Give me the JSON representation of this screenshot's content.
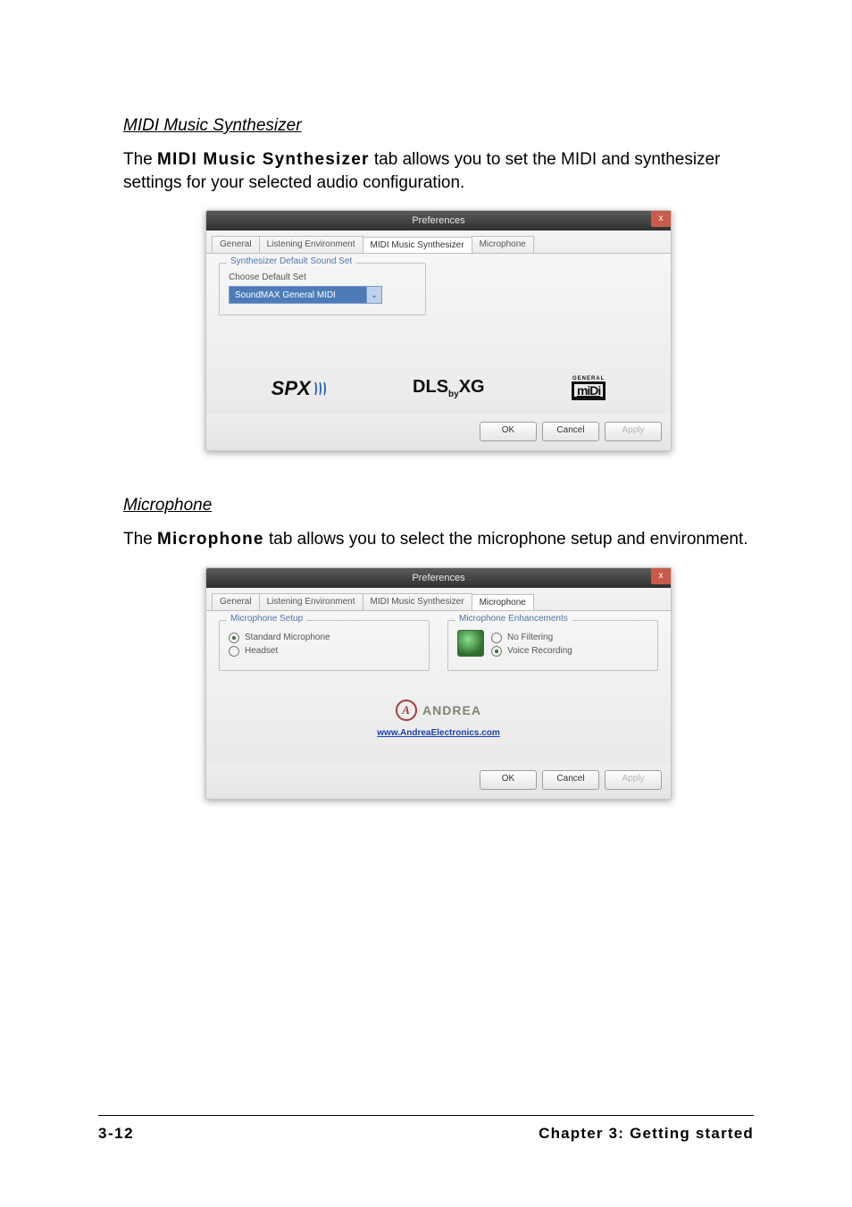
{
  "section1": {
    "heading": "MIDI Music Synthesizer",
    "text_before": "The ",
    "text_bold": "MIDI Music Synthesizer",
    "text_after": " tab allows you to set the MIDI and synthesizer settings for your selected audio configuration."
  },
  "dialog1": {
    "title": "Preferences",
    "close": "x",
    "tabs": [
      "General",
      "Listening Environment",
      "MIDI Music Synthesizer",
      "Microphone"
    ],
    "active_tab": 2,
    "group_legend": "Synthesizer Default Sound Set",
    "group_label": "Choose Default Set",
    "dropdown_value": "SoundMAX General MIDI",
    "logos": {
      "spx": "SPX",
      "dls_pre": "DLS",
      "dls_by": "by",
      "dls_suf": "XG",
      "midi_top": "GENERAL",
      "midi_bottom": "miDi"
    },
    "buttons": {
      "ok": "OK",
      "cancel": "Cancel",
      "apply": "Apply"
    }
  },
  "section2": {
    "heading": "Microphone",
    "text_before": "The ",
    "text_bold": "Microphone",
    "text_after": " tab allows you to select the microphone setup and environment."
  },
  "dialog2": {
    "title": "Preferences",
    "close": "x",
    "tabs": [
      "General",
      "Listening Environment",
      "MIDI Music Synthesizer",
      "Microphone"
    ],
    "active_tab": 3,
    "group1_legend": "Microphone Setup",
    "group1_opt1": "Standard Microphone",
    "group1_opt2": "Headset",
    "group2_legend": "Microphone Enhancements",
    "group2_opt1": "No Filtering",
    "group2_opt2": "Voice Recording",
    "andrea_text": "ANDREA",
    "andrea_a": "A",
    "andrea_link": "www.AndreaElectronics.com",
    "buttons": {
      "ok": "OK",
      "cancel": "Cancel",
      "apply": "Apply"
    }
  },
  "footer": {
    "page": "3-12",
    "chapter": "Chapter 3: Getting started"
  }
}
